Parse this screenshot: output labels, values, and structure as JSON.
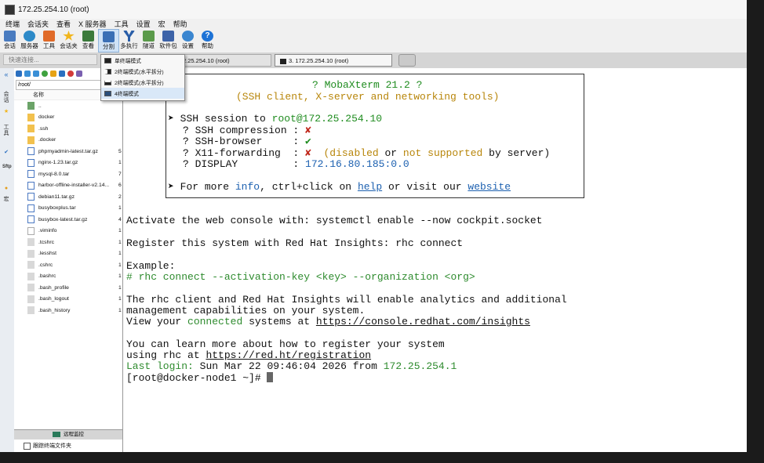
{
  "window": {
    "title": "172.25.254.10 (root)"
  },
  "menu": [
    "终端",
    "会话夹",
    "查看",
    "X 服务器",
    "工具",
    "设置",
    "宏",
    "帮助"
  ],
  "toolbar": [
    {
      "label": "会话",
      "icon": "session-icon",
      "color": "#4a7cc0"
    },
    {
      "label": "服务器",
      "icon": "servers-icon",
      "color": "#2d8ac8"
    },
    {
      "label": "工具",
      "icon": "tools-icon",
      "color": "#e06a28"
    },
    {
      "label": "会话夹",
      "icon": "star-icon",
      "color": "#f1b51c"
    },
    {
      "label": "查看",
      "icon": "view-icon",
      "color": "#3b7a3b"
    },
    {
      "label": "分割",
      "icon": "split-icon",
      "color": "#3a6fb5"
    },
    {
      "label": "多执行",
      "icon": "multiexec-icon",
      "color": "#2a5ea8"
    },
    {
      "label": "隧道",
      "icon": "tunnel-icon",
      "color": "#5a9a4a"
    },
    {
      "label": "软件包",
      "icon": "packages-icon",
      "color": "#3d63a8"
    },
    {
      "label": "设置",
      "icon": "settings-icon",
      "color": "#3a86d0"
    },
    {
      "label": "帮助",
      "icon": "help-icon",
      "color": "#1e73d6"
    }
  ],
  "quick_connect": {
    "placeholder": "快速连接..."
  },
  "tabs": [
    {
      "label": "2.25.254.10 (root)"
    },
    {
      "label": "3. 172.25.254.10 (root)"
    },
    {
      "label": ""
    }
  ],
  "split_menu": [
    {
      "label": "单终端模式"
    },
    {
      "label": "2终端模式(水平拆分)"
    },
    {
      "label": "2终端模式(水平拆分)"
    },
    {
      "label": "4终端模式"
    }
  ],
  "sidebar": {
    "labels": [
      "会话",
      "工具",
      "Sftp",
      "宏"
    ]
  },
  "files": {
    "path": "/root/",
    "column": "名称",
    "rows": [
      {
        "name": "..",
        "size": "",
        "type": "up"
      },
      {
        "name": "docker",
        "size": "",
        "type": "folder"
      },
      {
        "name": ".ssh",
        "size": "",
        "type": "folder"
      },
      {
        "name": ".docker",
        "size": "",
        "type": "folder"
      },
      {
        "name": "phpmyadmin-latest.tar.gz",
        "size": "5",
        "type": "archive"
      },
      {
        "name": "nginx-1.23.tar.gz",
        "size": "1",
        "type": "archive"
      },
      {
        "name": "mysql-8.0.tar",
        "size": "7",
        "type": "archive"
      },
      {
        "name": "harbor-offline-installer-v2.14...",
        "size": "6",
        "type": "archive"
      },
      {
        "name": "debian11.tar.gz",
        "size": "2",
        "type": "archive"
      },
      {
        "name": "busyboxplus.tar",
        "size": "1",
        "type": "archive"
      },
      {
        "name": "busybox-latest.tar.gz",
        "size": "4",
        "type": "archive"
      },
      {
        "name": ".viminfo",
        "size": "1",
        "type": "dotfile"
      },
      {
        "name": ".tcshrc",
        "size": "1",
        "type": "plain"
      },
      {
        "name": ".lesshst",
        "size": "1",
        "type": "plain"
      },
      {
        "name": ".cshrc",
        "size": "1",
        "type": "plain"
      },
      {
        "name": ".bashrc",
        "size": "1",
        "type": "plain"
      },
      {
        "name": ".bash_profile",
        "size": "1",
        "type": "plain"
      },
      {
        "name": ".bash_logout",
        "size": "1",
        "type": "plain"
      },
      {
        "name": ".bash_history",
        "size": "1",
        "type": "plain"
      }
    ],
    "monitor_label": "远程监控",
    "follow_label": "跟踪终端文件夹"
  },
  "terminal": {
    "banner_title": "? MobaXterm 21.2 ?",
    "banner_subtitle": "(SSH client, X-server and networking tools)",
    "ssh_prefix": "SSH session to",
    "ssh_target": "root@172.25.254.10",
    "compression_label": "? SSH compression : ",
    "compression_val": "✘",
    "browser_label": "? SSH-browser     : ",
    "browser_val": "✔",
    "x11_label": "? X11-forwarding  : ",
    "x11_val": "✘",
    "x11_note_a": "(disabled",
    "x11_note_or": "or",
    "x11_note_b": "not",
    "x11_note_c": "supported",
    "x11_note_d": "by server)",
    "display_label": "? DISPLAY         : ",
    "display_val": "172.16.80.185:0.0",
    "more_a": "For more",
    "more_info": "info",
    "more_b": ", ctrl+click on",
    "more_help": "help",
    "more_c": "or visit our",
    "more_web": "website",
    "line_activate": "Activate the web console with: systemctl enable --now cockpit.socket",
    "line_register": "Register this system with Red Hat Insights: rhc connect",
    "line_example": "Example:",
    "line_rhc": "# rhc connect --activation-key <key> --organization <org>",
    "line_client": "The rhc client and Red Hat Insights will enable analytics and additional",
    "line_mgmt": "management capabilities on your system.",
    "view_a": "View your",
    "view_connected": "connected",
    "view_b": "systems at",
    "view_url": "https://console.redhat.com/insights",
    "line_learn": "You can learn more about how to register your system",
    "rhc_a": "using rhc at",
    "rhc_url": "https://red.ht/registration",
    "last_a": "Last login:",
    "last_b": "Sun Mar 22 09:46:04 2026",
    "last_c": "from",
    "last_ip": "172.25.254.1",
    "prompt": "[root@docker-node1 ~]# "
  }
}
